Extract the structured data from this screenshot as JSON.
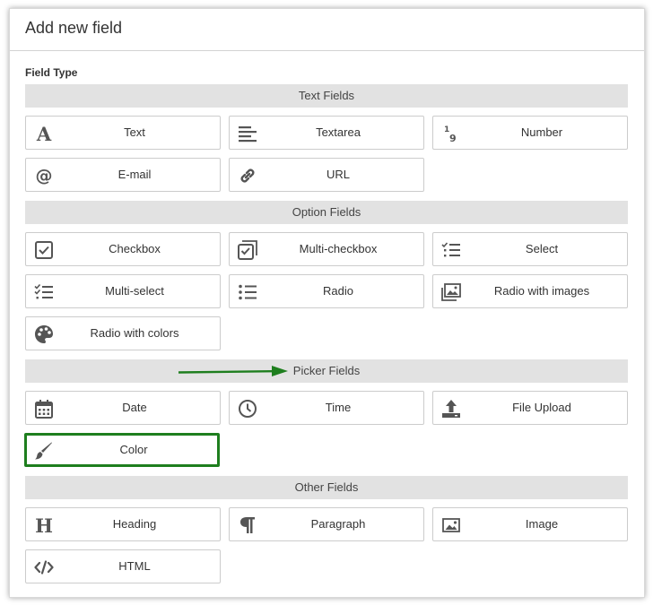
{
  "dialog": {
    "title": "Add new field",
    "field_type_label": "Field Type"
  },
  "groups": {
    "text": {
      "header": "Text Fields",
      "items": [
        {
          "label": "Text",
          "icon": "text-icon"
        },
        {
          "label": "Textarea",
          "icon": "textarea-icon"
        },
        {
          "label": "Number",
          "icon": "number-icon"
        },
        {
          "label": "E-mail",
          "icon": "email-icon"
        },
        {
          "label": "URL",
          "icon": "link-icon"
        }
      ]
    },
    "option": {
      "header": "Option Fields",
      "items": [
        {
          "label": "Checkbox",
          "icon": "checkbox-icon"
        },
        {
          "label": "Multi-checkbox",
          "icon": "multi-checkbox-icon"
        },
        {
          "label": "Select",
          "icon": "select-list-icon"
        },
        {
          "label": "Multi-select",
          "icon": "multi-select-list-icon"
        },
        {
          "label": "Radio",
          "icon": "radio-list-icon"
        },
        {
          "label": "Radio with images",
          "icon": "images-icon"
        },
        {
          "label": "Radio with colors",
          "icon": "palette-icon"
        }
      ]
    },
    "picker": {
      "header": "Picker Fields",
      "items": [
        {
          "label": "Date",
          "icon": "calendar-icon"
        },
        {
          "label": "Time",
          "icon": "clock-icon"
        },
        {
          "label": "File Upload",
          "icon": "upload-icon"
        },
        {
          "label": "Color",
          "icon": "paintbrush-icon"
        }
      ]
    },
    "other": {
      "header": "Other Fields",
      "items": [
        {
          "label": "Heading",
          "icon": "heading-icon"
        },
        {
          "label": "Paragraph",
          "icon": "paragraph-icon"
        },
        {
          "label": "Image",
          "icon": "image-icon"
        },
        {
          "label": "HTML",
          "icon": "code-icon"
        }
      ]
    }
  },
  "annotations": {
    "arrow_color": "#1e7e1e",
    "highlight_color": "#1e7e1e"
  },
  "colors": {
    "group_header_bg": "#e2e2e2",
    "tile_border": "#cccccc",
    "icon_color": "#555555"
  }
}
